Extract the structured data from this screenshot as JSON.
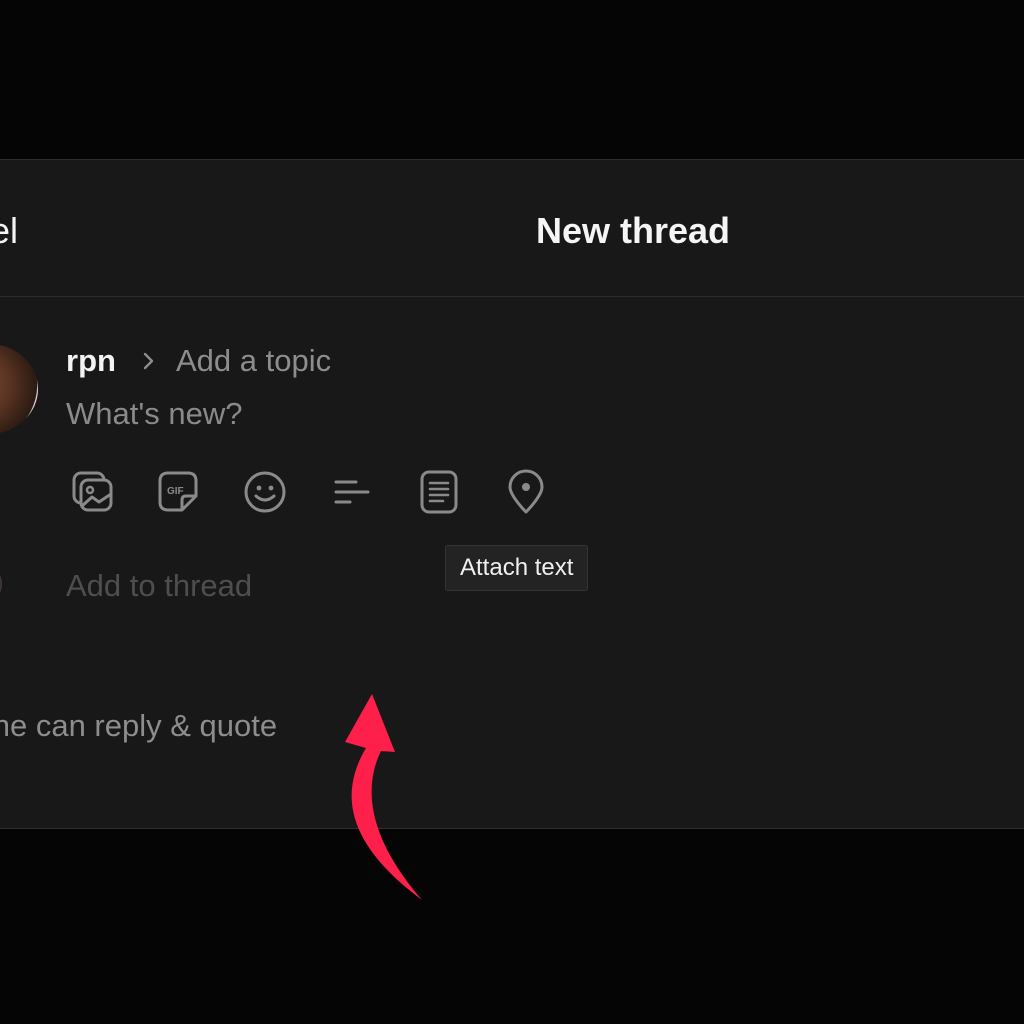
{
  "header": {
    "cancel_label": "ncel",
    "title": "New thread"
  },
  "composer": {
    "username": "rpn",
    "topic_placeholder": "Add a topic",
    "text_placeholder": "What's new?",
    "toolbar_icons": [
      "gallery-icon",
      "gif-icon",
      "emoji-icon",
      "poll-icon",
      "attach-text-icon",
      "location-icon"
    ],
    "add_to_thread_placeholder": "Add to thread"
  },
  "tooltip": {
    "text": "Attach text"
  },
  "footer": {
    "reply_setting": "yone can reply & quote"
  },
  "colors": {
    "background": "#050505",
    "modal": "#181818",
    "text_primary": "#f3f3f3",
    "text_secondary": "#8d8d8d",
    "annotation_arrow": "#ff1f4b"
  }
}
